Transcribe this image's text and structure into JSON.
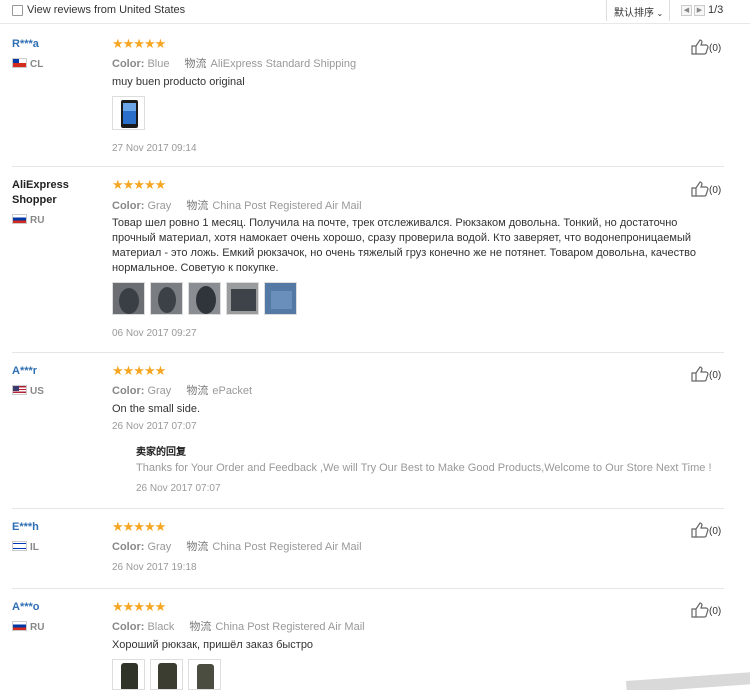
{
  "toolbar": {
    "checkbox_label": "View reviews from United States",
    "sort_label": "默认排序",
    "page_indicator": "1/3"
  },
  "reviews": [
    {
      "user": "R***a",
      "country": "CL",
      "stars": "★★★★★",
      "color_label": "Color:",
      "color_value": "Blue",
      "logistics_label": "物流",
      "shipping": "AliExpress Standard Shipping",
      "text": "muy buen producto original",
      "date": "27 Nov 2017 09:14",
      "likes": "(0)"
    },
    {
      "user": "AliExpress Shopper",
      "country": "RU",
      "stars": "★★★★★",
      "color_label": "Color:",
      "color_value": "Gray",
      "logistics_label": "物流",
      "shipping": "China Post Registered Air Mail",
      "text": "Товар шел ровно 1 месяц. Получила на почте, трек отслеживался. Рюкзаком довольна. Тонкий, но достаточно прочный материал, хотя намокает очень хорошо, сразу проверила водой. Кто заверяет, что водонепроницаемый материал - это ложь. Емкий рюкзачок, но очень тяжелый груз конечно же не потянет. Товаром довольна, качество нормальное. Советую к покупке.",
      "date": "06 Nov 2017 09:27",
      "likes": "(0)"
    },
    {
      "user": "A***r",
      "country": "US",
      "stars": "★★★★★",
      "color_label": "Color:",
      "color_value": "Gray",
      "logistics_label": "物流",
      "shipping": "ePacket",
      "text": "On the small side.",
      "date": "26 Nov 2017 07:07",
      "likes": "(0)",
      "reply": {
        "title": "卖家的回复",
        "text": "Thanks for Your Order and Feedback ,We will Try Our Best to Make Good Products,Welcome to Our Store Next Time !",
        "date": "26 Nov 2017 07:07"
      }
    },
    {
      "user": "E***h",
      "country": "IL",
      "stars": "★★★★★",
      "color_label": "Color:",
      "color_value": "Gray",
      "logistics_label": "物流",
      "shipping": "China Post Registered Air Mail",
      "date": "26 Nov 2017 19:18",
      "likes": "(0)"
    },
    {
      "user": "A***o",
      "country": "RU",
      "stars": "★★★★★",
      "color_label": "Color:",
      "color_value": "Black",
      "logistics_label": "物流",
      "shipping": "China Post Registered Air Mail",
      "text": "Хороший рюкзак, пришёл заказ быстро",
      "likes": "(0)"
    }
  ],
  "colors": {
    "username": "#2f6fb3",
    "star": "#f5a623",
    "muted": "#999999"
  },
  "icons": [
    "checkbox",
    "chevron-down-icon",
    "prev-page-icon",
    "next-page-icon",
    "thumbs-up-icon"
  ]
}
